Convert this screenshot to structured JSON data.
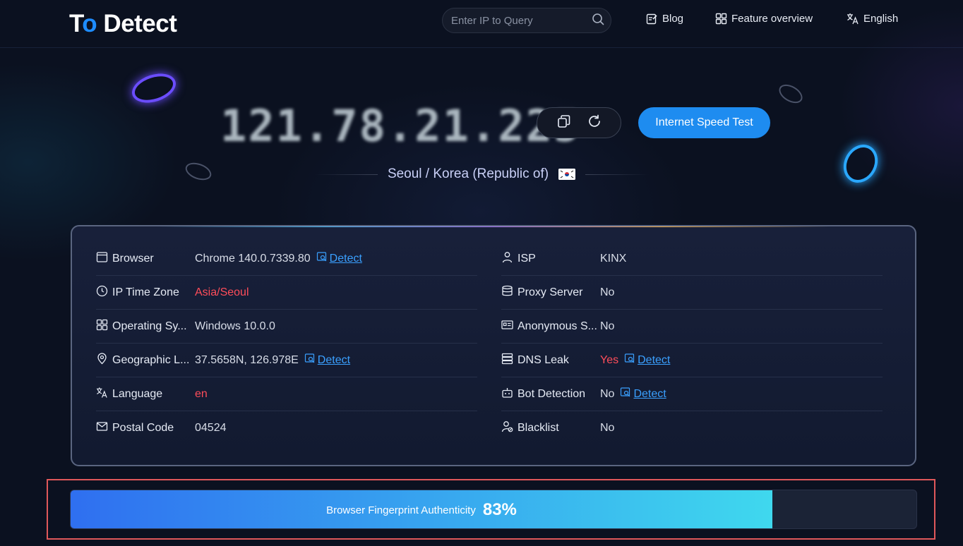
{
  "header": {
    "logo_text_1": "T",
    "logo_text_2": "o",
    "logo_text_3": " Detect",
    "search_placeholder": "Enter IP to Query",
    "nav": [
      {
        "label": "Blog",
        "icon": "edit-icon"
      },
      {
        "label": "Feature overview",
        "icon": "grid-icon"
      },
      {
        "label": "English",
        "icon": "translate-icon"
      }
    ]
  },
  "ip": {
    "address": "121.78.21.225",
    "speed_test_label": "Internet Speed Test",
    "location": "Seoul / Korea (Republic of)"
  },
  "info_left": [
    {
      "label": "Browser",
      "icon": "browser-icon",
      "value": "Chrome 140.0.7339.80",
      "detect": "Detect",
      "value_color": "normal"
    },
    {
      "label": "IP Time Zone",
      "icon": "clock-icon",
      "value": "Asia/Seoul",
      "detect": "",
      "value_color": "red"
    },
    {
      "label": "Operating Sy...",
      "icon": "apps-icon",
      "value": "Windows 10.0.0",
      "detect": "",
      "value_color": "normal"
    },
    {
      "label": "Geographic L...",
      "icon": "location-icon",
      "value": "37.5658N, 126.978E",
      "detect": "Detect",
      "value_color": "normal"
    },
    {
      "label": "Language",
      "icon": "translate-icon",
      "value": "en",
      "detect": "",
      "value_color": "red"
    },
    {
      "label": "Postal Code",
      "icon": "mail-icon",
      "value": "04524",
      "detect": "",
      "value_color": "normal"
    }
  ],
  "info_right": [
    {
      "label": "ISP",
      "icon": "user-icon",
      "value": "KINX",
      "detect": "",
      "value_color": "normal"
    },
    {
      "label": "Proxy Server",
      "icon": "database-icon",
      "value": "No",
      "detect": "",
      "value_color": "normal"
    },
    {
      "label": "Anonymous S...",
      "icon": "id-card-icon",
      "value": "No",
      "detect": "",
      "value_color": "normal"
    },
    {
      "label": "DNS Leak",
      "icon": "server-icon",
      "value": "Yes",
      "detect": "Detect",
      "value_color": "red"
    },
    {
      "label": "Bot Detection",
      "icon": "robot-icon",
      "value": "No",
      "detect": "Detect",
      "value_color": "normal"
    },
    {
      "label": "Blacklist",
      "icon": "user-block-icon",
      "value": "No",
      "detect": "",
      "value_color": "normal"
    }
  ],
  "fingerprint": {
    "label": "Browser Fingerprint Authenticity",
    "percent_text": "83%",
    "value": 0.83
  },
  "colors": {
    "accent": "#1e8cf0",
    "link": "#3aa0ff",
    "warning": "#ff4d5a",
    "highlight_border": "#e0585a"
  }
}
